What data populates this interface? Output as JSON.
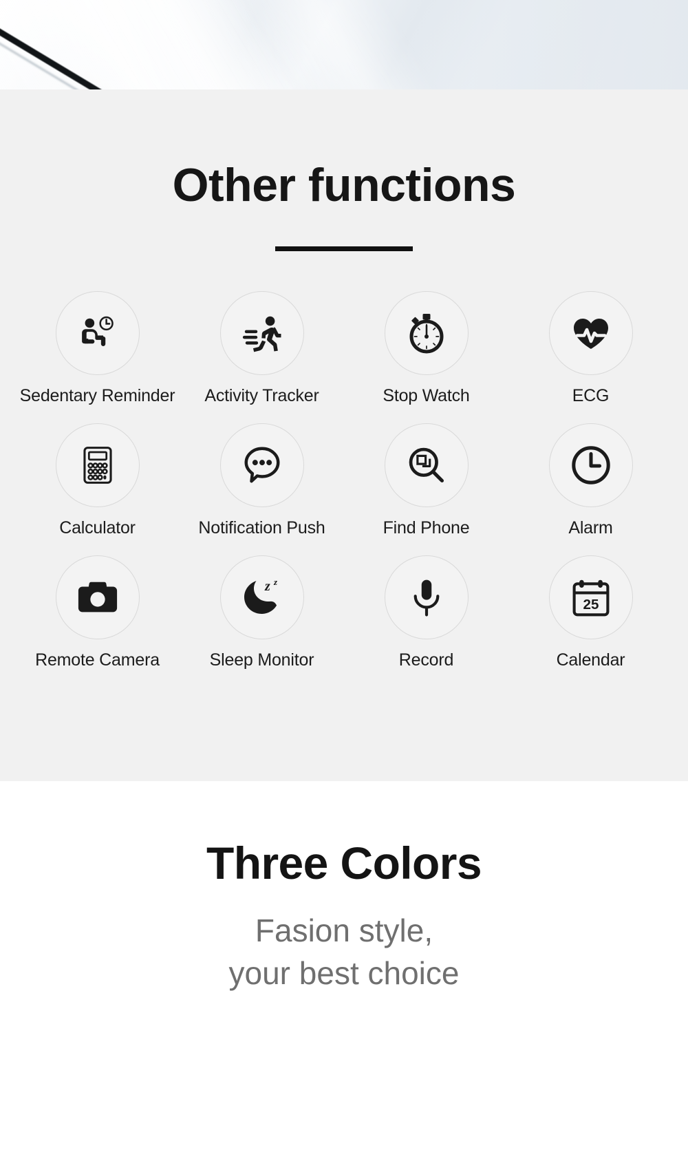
{
  "hero": {
    "name": "product-photo-band",
    "description": "light blue-grey product surface with dark diagonal edge line"
  },
  "functions_section": {
    "title": "Other functions",
    "divider_color": "#111111",
    "background_color": "#f1f1f1",
    "items": [
      {
        "label": "Sedentary Reminder",
        "icon": "sedentary-reminder-icon"
      },
      {
        "label": "Activity Tracker",
        "icon": "running-person-icon"
      },
      {
        "label": "Stop Watch",
        "icon": "stopwatch-icon"
      },
      {
        "label": "ECG",
        "icon": "heart-pulse-icon"
      },
      {
        "label": "Calculator",
        "icon": "calculator-icon"
      },
      {
        "label": "Notification Push",
        "icon": "chat-bubble-dots-icon"
      },
      {
        "label": "Find Phone",
        "icon": "magnifier-phone-icon"
      },
      {
        "label": "Alarm",
        "icon": "clock-icon"
      },
      {
        "label": "Remote Camera",
        "icon": "camera-icon"
      },
      {
        "label": "Sleep Monitor",
        "icon": "moon-z-icon"
      },
      {
        "label": "Record",
        "icon": "microphone-icon"
      },
      {
        "label": "Calendar",
        "icon": "calendar-icon"
      }
    ],
    "calendar_day": "25"
  },
  "colors_section": {
    "title": "Three Colors",
    "subtitle_line1": "Fasion style,",
    "subtitle_line2": "your best choice",
    "background_color": "#ffffff",
    "subtitle_color": "#6f6f6f"
  }
}
